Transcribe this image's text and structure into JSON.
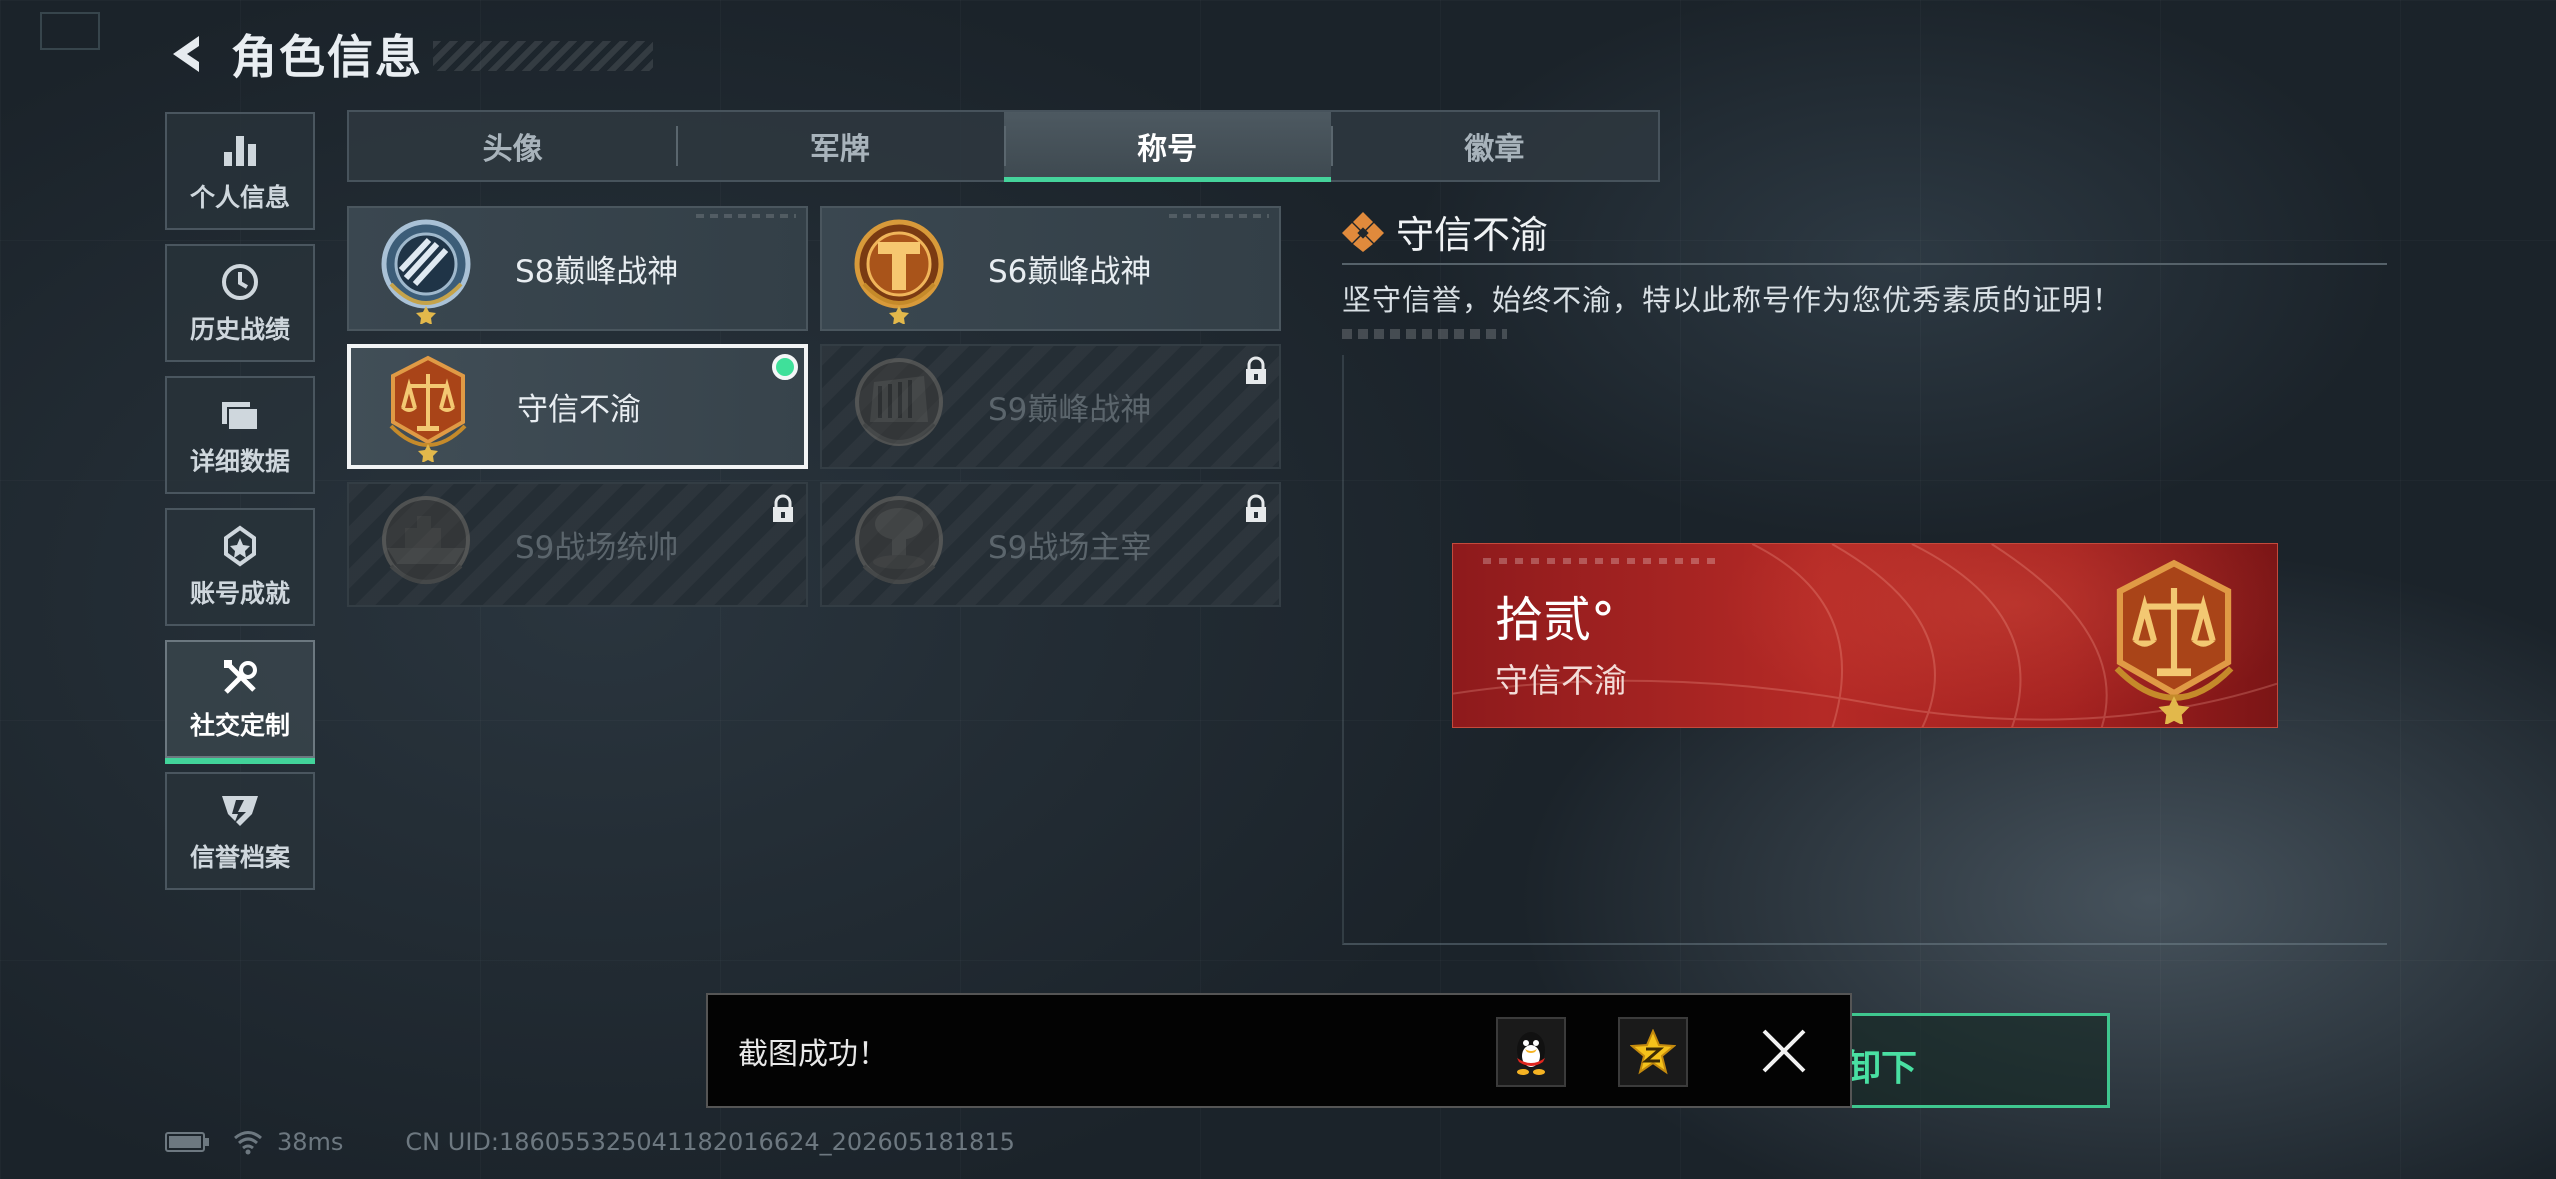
{
  "header": {
    "title": "角色信息"
  },
  "sidebar": {
    "items": [
      {
        "label": "个人信息",
        "icon": "bar-chart-icon"
      },
      {
        "label": "历史战绩",
        "icon": "history-clock-icon"
      },
      {
        "label": "详细数据",
        "icon": "folder-data-icon"
      },
      {
        "label": "账号成就",
        "icon": "achievement-badge-icon"
      },
      {
        "label": "社交定制",
        "icon": "tools-icon",
        "active": true
      },
      {
        "label": "信誉档案",
        "icon": "credit-shield-icon"
      }
    ]
  },
  "tabs": [
    {
      "label": "头像"
    },
    {
      "label": "军牌"
    },
    {
      "label": "称号",
      "active": true
    },
    {
      "label": "徽章"
    }
  ],
  "titles": [
    {
      "name": "S8巅峰战神",
      "emblem": "s8-globe-emblem-icon",
      "locked": false
    },
    {
      "name": "S6巅峰战神",
      "emblem": "s6-t-emblem-icon",
      "locked": false
    },
    {
      "name": "守信不渝",
      "emblem": "scales-emblem-icon",
      "locked": false,
      "equipped": true
    },
    {
      "name": "S9巅峰战神",
      "emblem": "s9-fortress-emblem-icon",
      "locked": true
    },
    {
      "name": "S9战场统帅",
      "emblem": "s9-warship-emblem-icon",
      "locked": true
    },
    {
      "name": "S9战场主宰",
      "emblem": "s9-mushroom-cloud-emblem-icon",
      "locked": true
    }
  ],
  "detail": {
    "title": "守信不渝",
    "description": "坚守信誉，始终不渝，特以此称号作为您优秀素质的证明！"
  },
  "banner": {
    "level": "拾贰°",
    "name": "守信不渝"
  },
  "equip_button": {
    "label": "卸下"
  },
  "toast": {
    "message": "截图成功！",
    "share_targets": [
      "qq-penguin-icon",
      "qzone-star-icon"
    ]
  },
  "status": {
    "ping": "38ms",
    "uid": "CN UID:186055325041182016624_202605181815"
  },
  "colors": {
    "accent_green": "#45d39b",
    "banner_red": "#b52a26",
    "emblem_gold": "#c98a2a"
  }
}
